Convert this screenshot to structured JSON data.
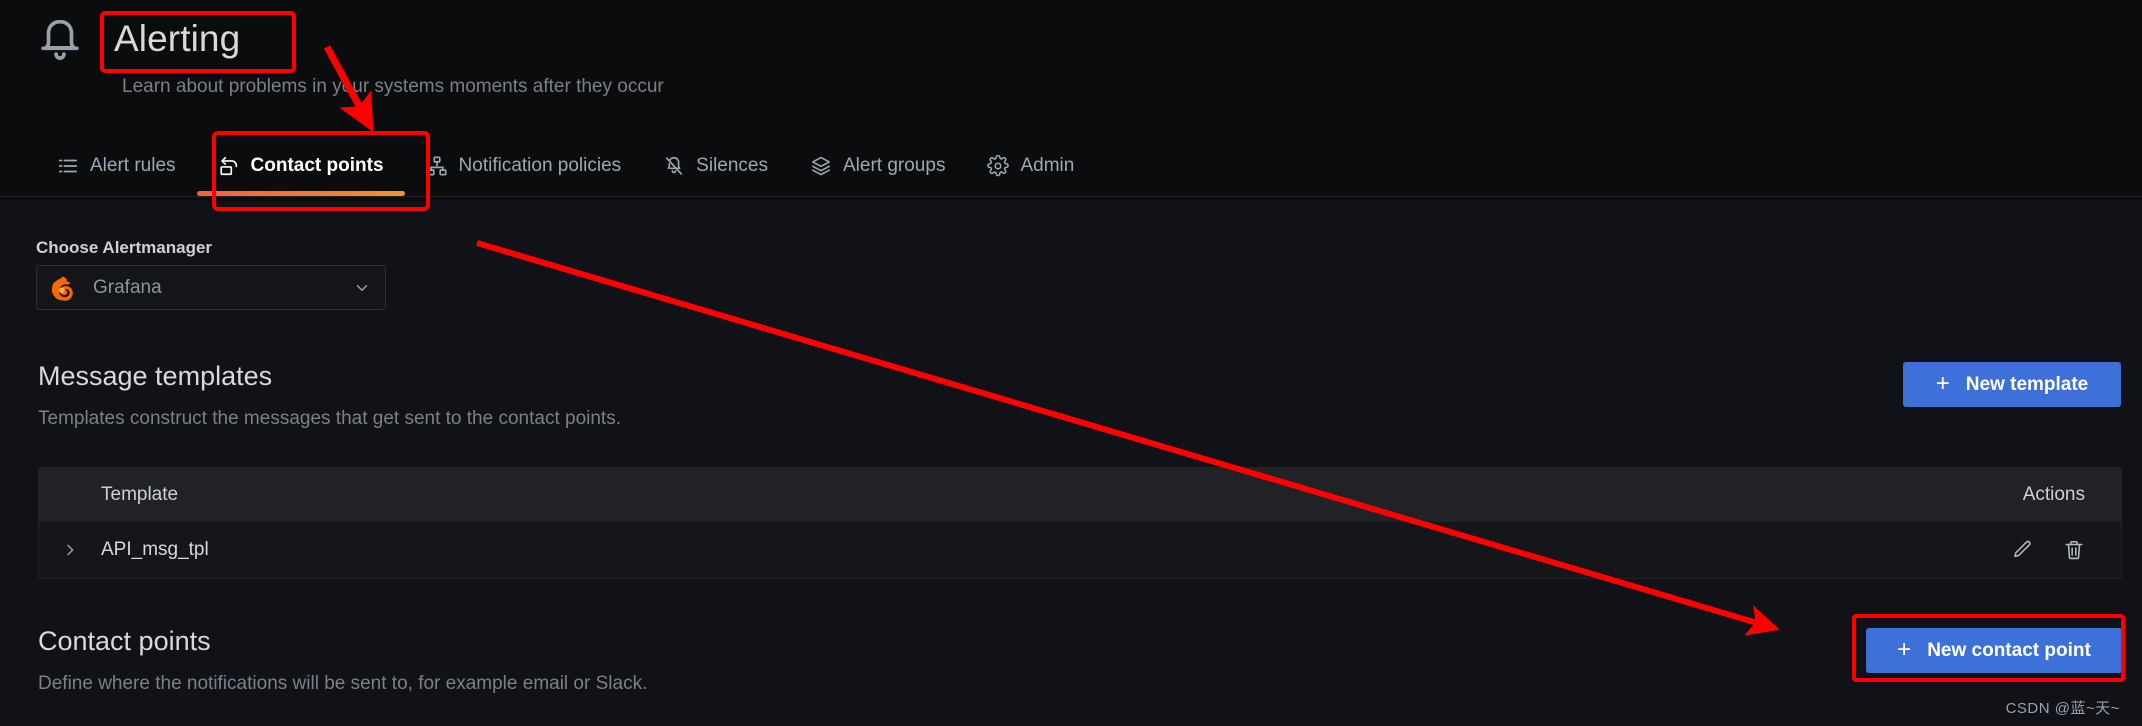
{
  "header": {
    "icon": "bell-icon",
    "title": "Alerting",
    "subtitle": "Learn about problems in your systems moments after they occur"
  },
  "tabs": [
    {
      "label": "Alert rules",
      "icon": "list-icon",
      "active": false
    },
    {
      "label": "Contact points",
      "icon": "reply-arrow-icon",
      "active": true
    },
    {
      "label": "Notification policies",
      "icon": "sitemap-icon",
      "active": false
    },
    {
      "label": "Silences",
      "icon": "bell-slash-icon",
      "active": false
    },
    {
      "label": "Alert groups",
      "icon": "layers-icon",
      "active": false
    },
    {
      "label": "Admin",
      "icon": "gear-icon",
      "active": false
    }
  ],
  "alertmanager": {
    "label": "Choose Alertmanager",
    "selected": "Grafana",
    "icon": "grafana-logo-icon",
    "chevron": "chevron-down-icon"
  },
  "message_templates": {
    "title": "Message templates",
    "description": "Templates construct the messages that get sent to the contact points.",
    "new_button": {
      "label": "New template",
      "icon": "plus-icon"
    },
    "table": {
      "columns": [
        "Template",
        "Actions"
      ],
      "rows": [
        {
          "expand_icon": "chevron-right-icon",
          "name": "API_msg_tpl",
          "actions": [
            "pencil-icon",
            "trash-icon"
          ]
        }
      ]
    }
  },
  "contact_points": {
    "title": "Contact points",
    "description": "Define where the notifications will be sent to, for example email or Slack.",
    "new_button": {
      "label": "New contact point",
      "icon": "plus-icon"
    }
  },
  "annotations": {
    "highlight_color": "#ff0000",
    "boxes": [
      "page-title",
      "contact-points-tab",
      "new-contact-point-button"
    ],
    "arrows": [
      "title-to-tab",
      "tab-to-new-contact-point-button"
    ]
  },
  "watermark": "CSDN @蓝~天~",
  "colors": {
    "page_background": "#111217",
    "header_background": "#0b0c0e",
    "primary_button": "#3d71d9",
    "tab_active_underline_start": "#f55f3e",
    "tab_active_underline_end": "#f2902f",
    "table_header_background": "#202226",
    "table_row_background": "#141619"
  }
}
